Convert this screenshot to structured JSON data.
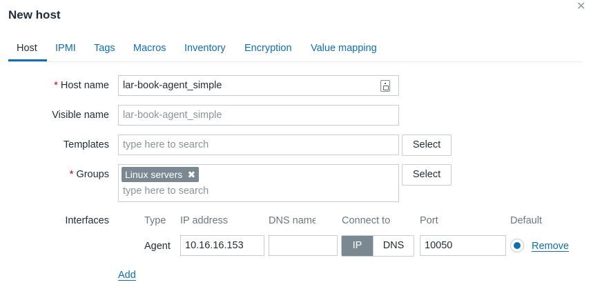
{
  "dialog": {
    "title": "New host",
    "close_icon": "close-icon"
  },
  "tabs": [
    {
      "label": "Host",
      "active": true
    },
    {
      "label": "IPMI"
    },
    {
      "label": "Tags"
    },
    {
      "label": "Macros"
    },
    {
      "label": "Inventory"
    },
    {
      "label": "Encryption"
    },
    {
      "label": "Value mapping"
    }
  ],
  "form": {
    "host_name": {
      "label": "Host name",
      "required_mark": "*",
      "value": "lar-book-agent_simple",
      "icon": "copy-icon"
    },
    "visible_name": {
      "label": "Visible name",
      "placeholder": "lar-book-agent_simple"
    },
    "templates": {
      "label": "Templates",
      "placeholder": "type here to search",
      "select_label": "Select"
    },
    "groups": {
      "label": "Groups",
      "required_mark": "*",
      "chip": "Linux servers",
      "chip_remove": "✖",
      "placeholder": "type here to search",
      "select_label": "Select"
    },
    "interfaces": {
      "label": "Interfaces",
      "columns": {
        "type": "Type",
        "ip": "IP address",
        "dns": "DNS name",
        "connect": "Connect to",
        "port": "Port",
        "default": "Default"
      },
      "row": {
        "type": "Agent",
        "ip": "10.16.16.153",
        "dns": "",
        "connect_ip": "IP",
        "connect_dns": "DNS",
        "port": "10050",
        "default_selected": true,
        "remove_label": "Remove"
      },
      "add_label": "Add"
    }
  },
  "colors": {
    "accent": "#0d6eb5",
    "required": "#d40000",
    "chip_bg": "#7a8891"
  }
}
